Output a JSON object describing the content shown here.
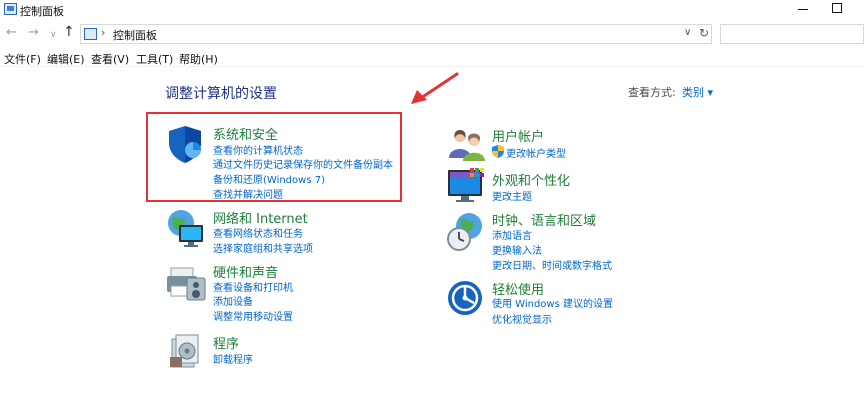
{
  "window": {
    "title": "控制面板"
  },
  "nav": {
    "back": "←",
    "forward": "→",
    "history": "∨",
    "up": "↑",
    "address_separator": "›",
    "address": "控制面板",
    "dropdown": "∨",
    "refresh": "↻"
  },
  "menu": {
    "file": "文件(F)",
    "edit": "编辑(E)",
    "view": "查看(V)",
    "tools": "工具(T)",
    "help": "帮助(H)"
  },
  "main": {
    "heading": "调整计算机的设置",
    "view_by_label": "查看方式:",
    "view_by_value": "类别 ▾"
  },
  "categories": {
    "system_security": {
      "title": "系统和安全",
      "links": [
        "查看你的计算机状态",
        "通过文件历史记录保存你的文件备份副本",
        "备份和还原(Windows 7)",
        "查找并解决问题"
      ]
    },
    "network": {
      "title": "网络和 Internet",
      "links": [
        "查看网络状态和任务",
        "选择家庭组和共享选项"
      ]
    },
    "hardware": {
      "title": "硬件和声音",
      "links": [
        "查看设备和打印机",
        "添加设备",
        "调整常用移动设置"
      ]
    },
    "programs": {
      "title": "程序",
      "links": [
        "卸载程序"
      ]
    },
    "user_accounts": {
      "title": "用户帐户",
      "links": [
        "更改帐户类型"
      ]
    },
    "appearance": {
      "title": "外观和个性化",
      "links": [
        "更改主题"
      ]
    },
    "clock_region": {
      "title": "时钟、语言和区域",
      "links": [
        "添加语言",
        "更换输入法",
        "更改日期、时间或数字格式"
      ]
    },
    "ease_of_access": {
      "title": "轻松使用",
      "links": [
        "使用 Windows 建议的设置",
        "优化视觉显示"
      ]
    }
  },
  "colors": {
    "category_title": "#1e7f3a",
    "link": "#0066cc",
    "heading": "#1e3287",
    "annotation_red": "#e53333"
  }
}
